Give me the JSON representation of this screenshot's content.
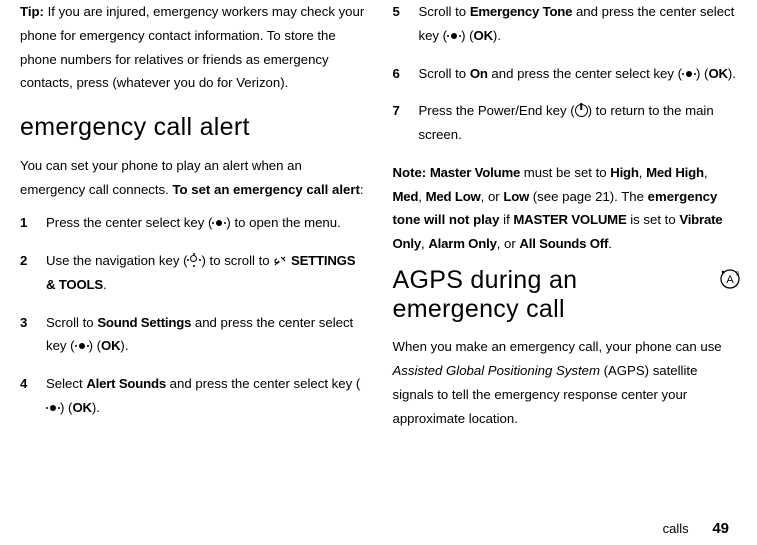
{
  "left": {
    "tip_label": "Tip:",
    "tip_text": " If you are injured, emergency workers may check your phone for emergency contact information. To store the phone numbers for relatives or friends as emergency contacts, press (whatever you do for Verizon).",
    "h2": "emergency call alert",
    "intro_a": "You can set your phone to play an alert when an emergency call connects. ",
    "intro_b": "To set an emergency call alert",
    "intro_c": ":",
    "steps": [
      {
        "num": "1",
        "a": "Press the center select key (",
        "b": ") to open the menu."
      },
      {
        "num": "2",
        "a": "Use the navigation key (",
        "b": ") to scroll to ",
        "c": "SETTINGS & TOOLS",
        "d": "."
      },
      {
        "num": "3",
        "a": "Scroll to ",
        "b": "Sound Settings",
        "c": " and press the center select key (",
        "d": ") (",
        "e": "OK",
        "f": ")."
      },
      {
        "num": "4",
        "a": "Select ",
        "b": "Alert Sounds",
        "c": " and press the center select key (",
        "d": ") (",
        "e": "OK",
        "f": ")."
      }
    ]
  },
  "right": {
    "steps": [
      {
        "num": "5",
        "a": "Scroll to ",
        "b": "Emergency Tone",
        "c": " and press the center select key (",
        "d": ") (",
        "e": "OK",
        "f": ")."
      },
      {
        "num": "6",
        "a": "Scroll to ",
        "b": "On",
        "c": " and press the center select key (",
        "d": ") (",
        "e": "OK",
        "f": ")."
      },
      {
        "num": "7",
        "a": "Press the Power/End key (",
        "b": ") to return to the main screen."
      }
    ],
    "note_label": "Note:",
    "note_a": " ",
    "note_mv": "Master Volume",
    "note_b": " must be set to ",
    "note_high": "High",
    "note_c": ", ",
    "note_medhigh": "Med High",
    "note_d": ", ",
    "note_med": "Med",
    "note_e": ", ",
    "note_medlow": "Med Low",
    "note_f": ", or ",
    "note_low": "Low",
    "note_g": " (see page 21). The ",
    "note_bold": "emergency tone will not play",
    "note_h": " if ",
    "note_mv2": "MASTER VOLUME",
    "note_i": " is set to ",
    "note_vib": "Vibrate Only",
    "note_j": ", ",
    "note_alarm": "Alarm Only",
    "note_k": ", or ",
    "note_aso": "All Sounds Off",
    "note_l": ".",
    "h2": "AGPS during an emergency call",
    "agps_a": "When you make an emergency call, your phone can use ",
    "agps_b": "Assisted Global Positioning System",
    "agps_c": " (AGPS) satellite signals to tell the emergency response center your approximate location."
  },
  "footer": {
    "section": "calls",
    "page": "49"
  }
}
